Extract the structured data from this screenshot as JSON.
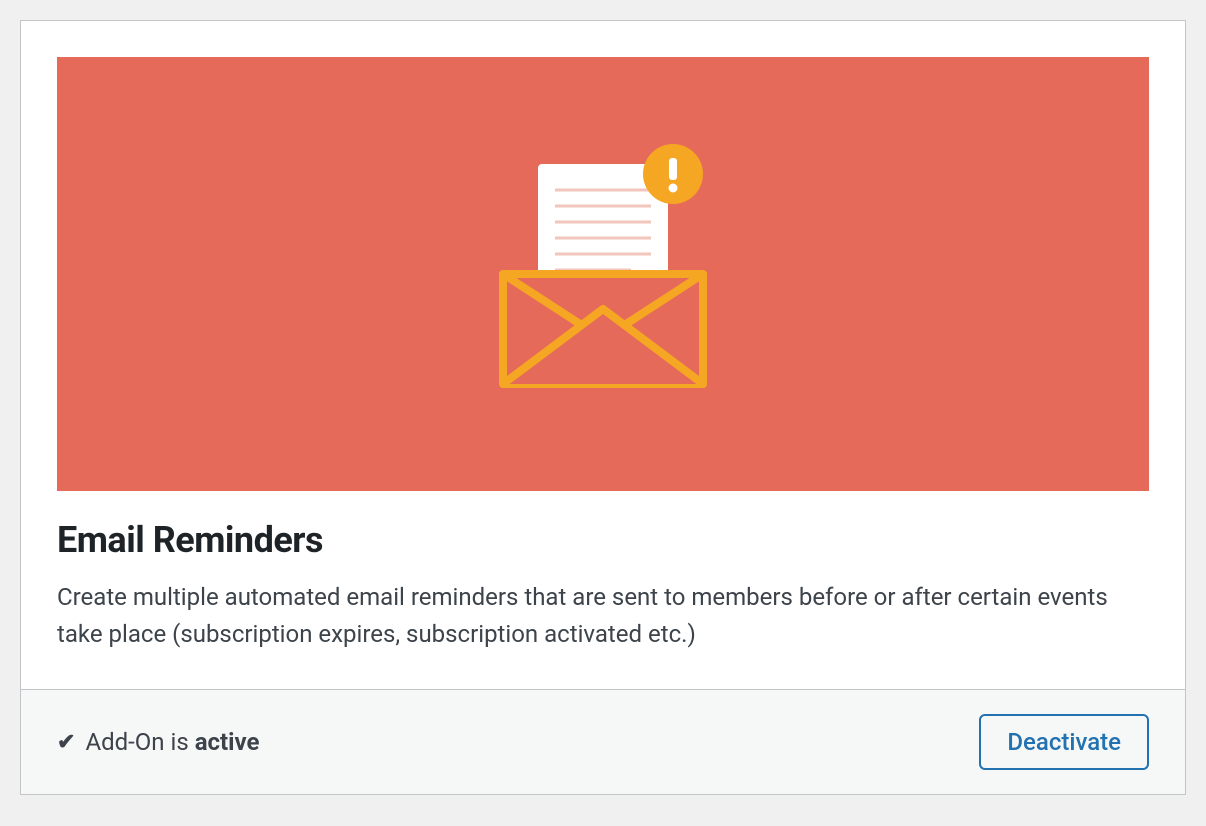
{
  "card": {
    "title": "Email Reminders",
    "description": "Create multiple automated email reminders that are sent to members before or after certain events take place (subscription expires, subscription activated etc.)"
  },
  "footer": {
    "status_prefix": "Add-On is ",
    "status_state": "active",
    "deactivate_label": "Deactivate"
  },
  "colors": {
    "hero_bg": "#e66a59",
    "envelope": "#f5a623",
    "paper": "#ffffff",
    "paper_lines": "#f2c6bb",
    "badge": "#f5a623",
    "link": "#2271b1"
  }
}
